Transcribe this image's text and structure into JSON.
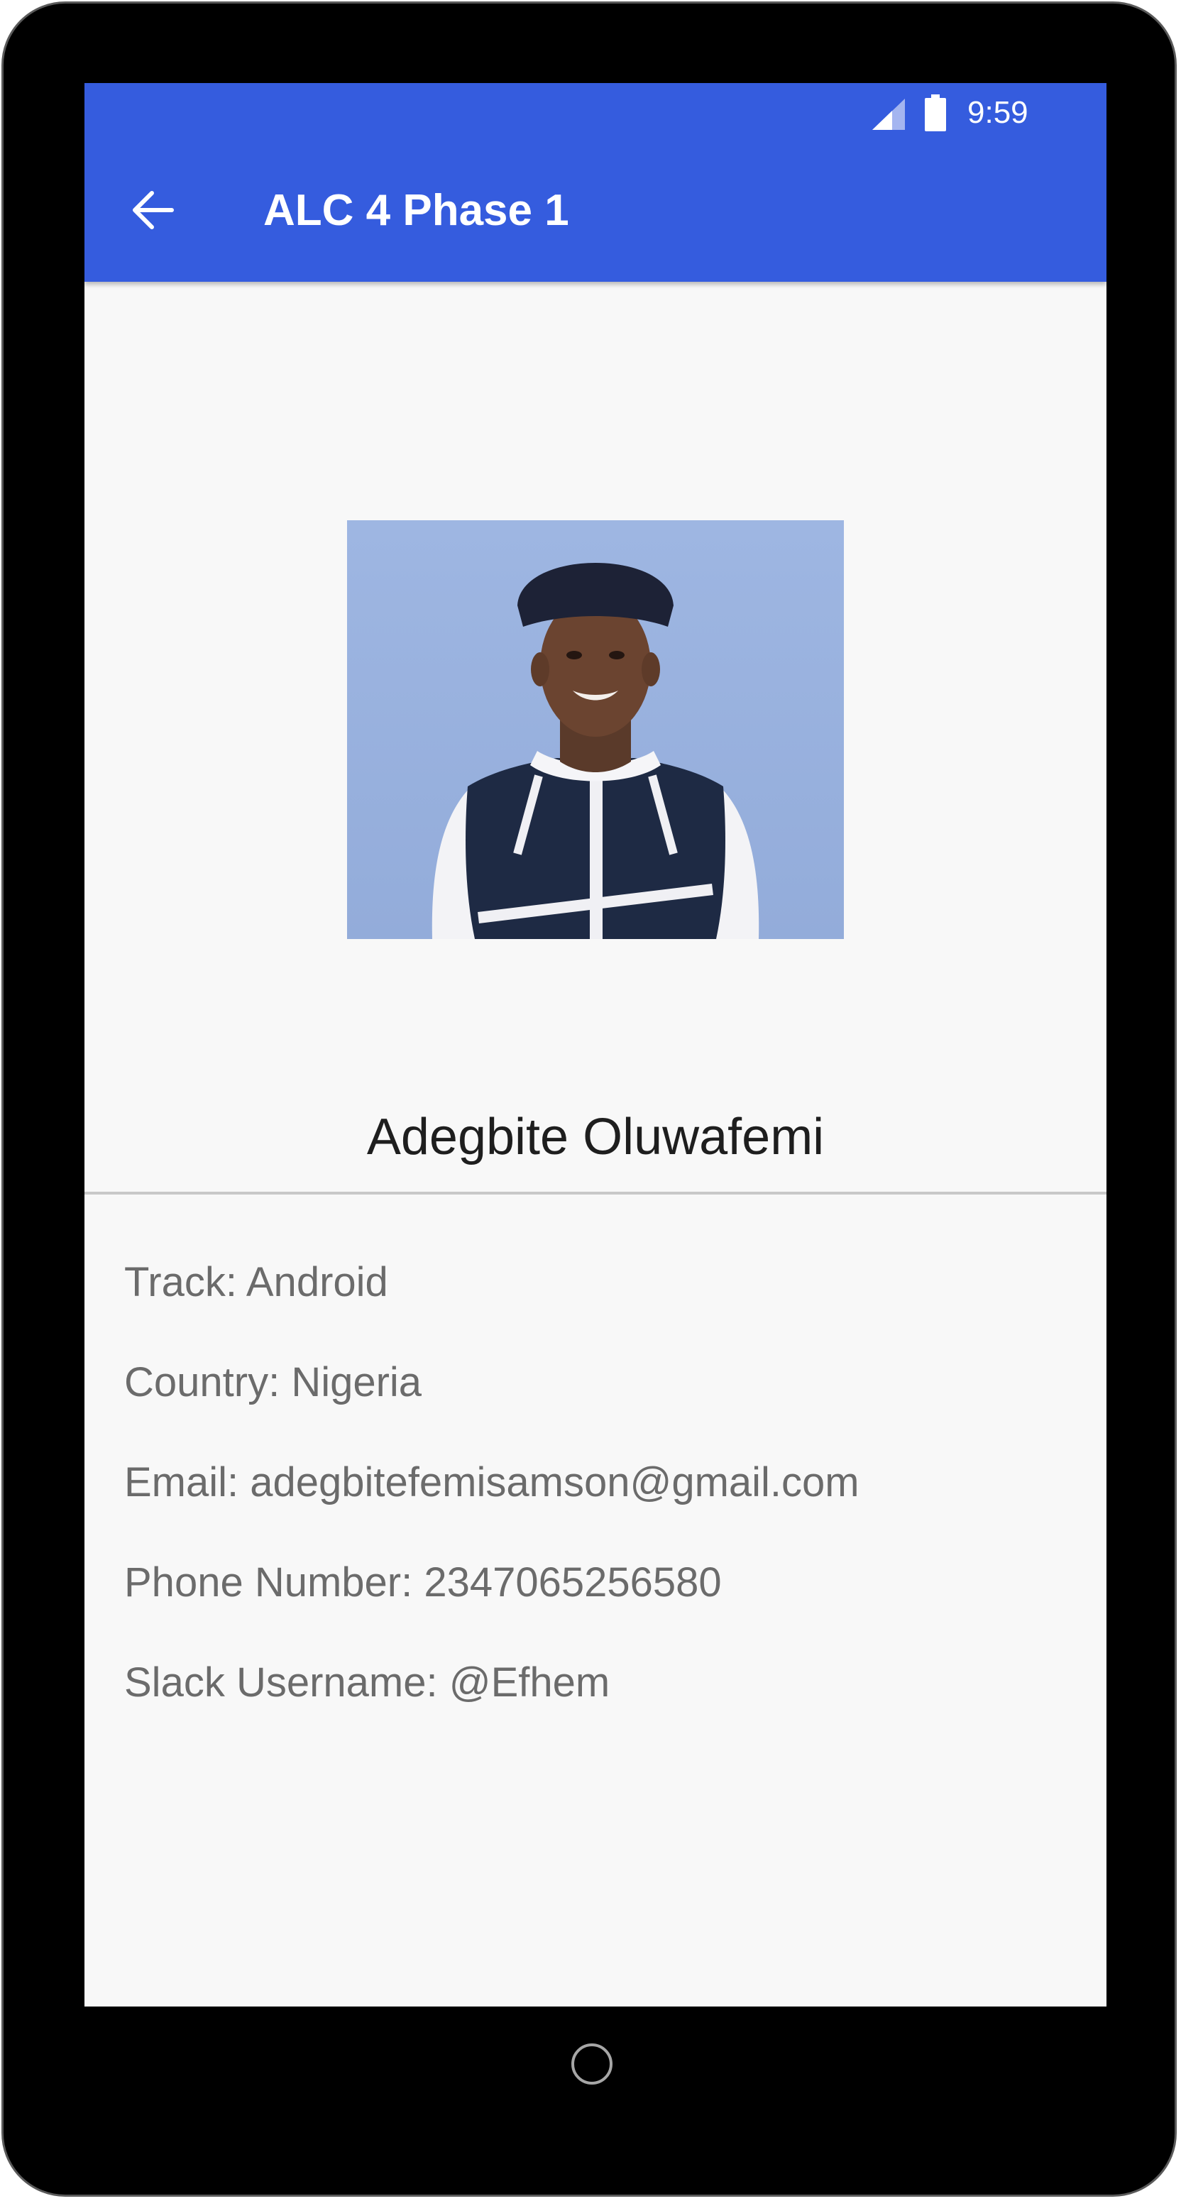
{
  "status_bar": {
    "time": "9:59",
    "icons": [
      "cellular-signal-icon",
      "battery-icon"
    ]
  },
  "toolbar": {
    "back_icon": "arrow-back-icon",
    "title": "ALC 4 Phase 1"
  },
  "profile": {
    "photo_alt": "profile-photo",
    "name": "Adegbite Oluwafemi",
    "details": [
      {
        "key": "track",
        "text": "Track: Android"
      },
      {
        "key": "country",
        "text": "Country: Nigeria"
      },
      {
        "key": "email",
        "text": "Email: adegbitefemisamson@gmail.com"
      },
      {
        "key": "phone",
        "text": "Phone Number: 2347065256580"
      },
      {
        "key": "slack",
        "text": "Slack Username: @Efhem"
      }
    ]
  },
  "colors": {
    "app_bar": "#355cde",
    "background": "#f8f8f8",
    "detail_text": "#6b6b6b",
    "name_text": "#1e1e1e"
  }
}
